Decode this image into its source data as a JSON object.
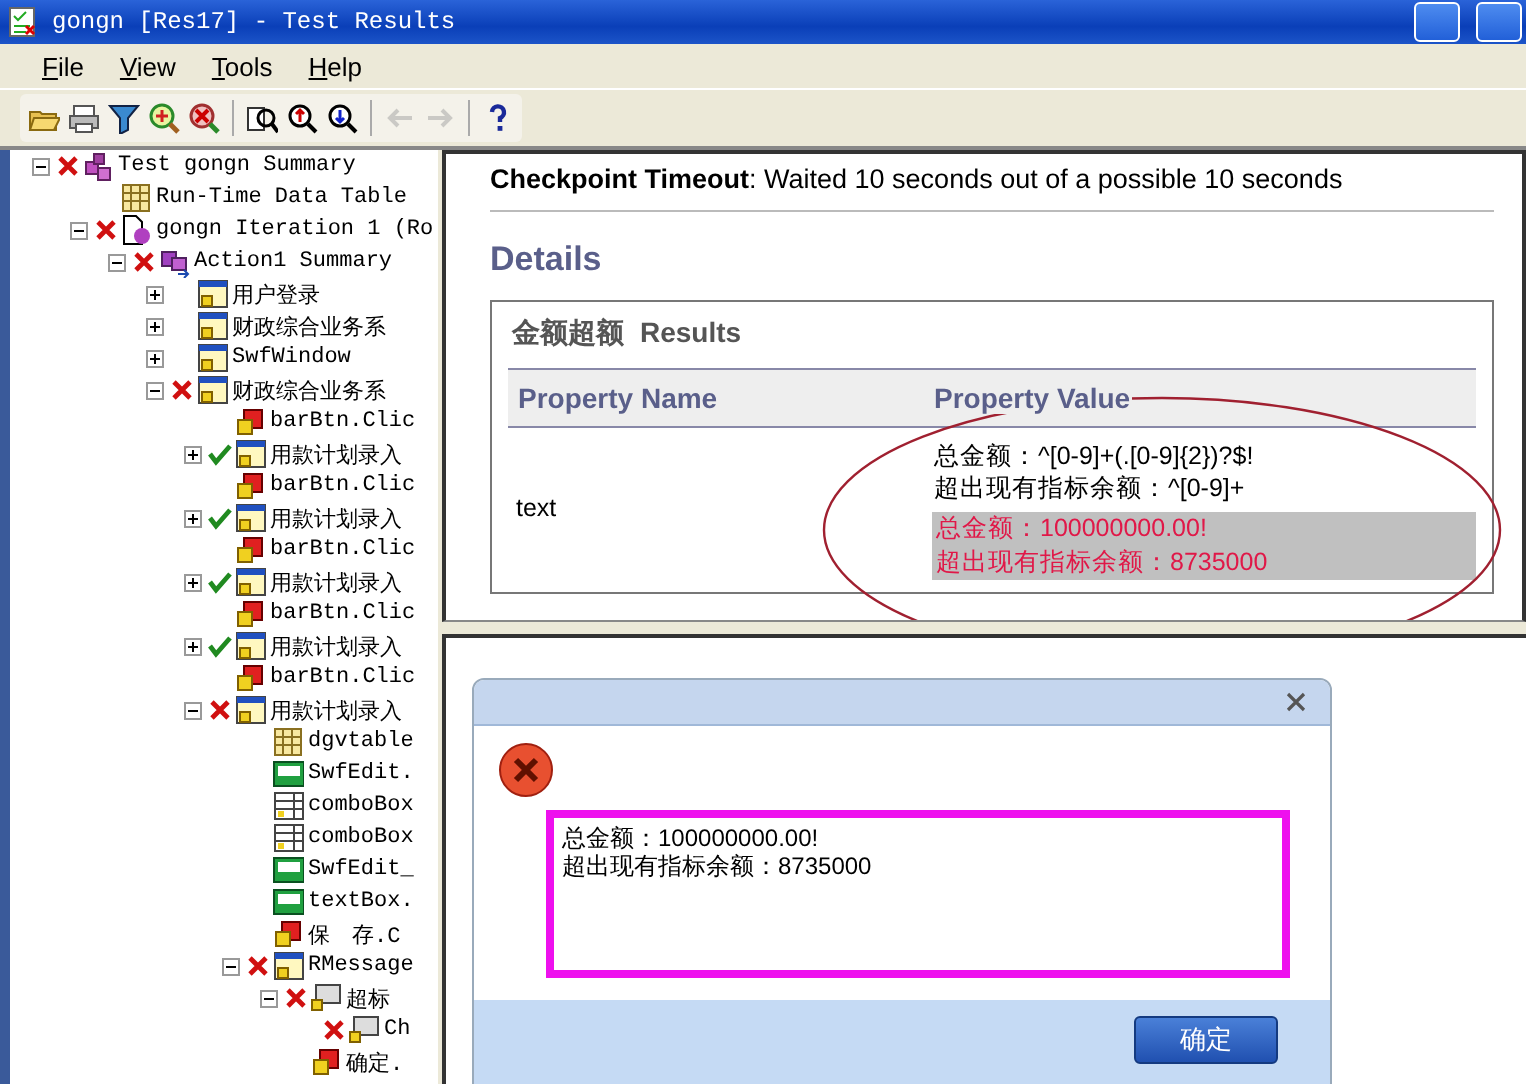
{
  "window": {
    "title": "gongn [Res17] - Test Results"
  },
  "menu": [
    {
      "label": "File"
    },
    {
      "label": "View"
    },
    {
      "label": "Tools"
    },
    {
      "label": "Help"
    }
  ],
  "toolbar": [
    {
      "kind": "open",
      "disabled": false
    },
    {
      "kind": "print",
      "disabled": false
    },
    {
      "kind": "filter",
      "disabled": false
    },
    {
      "kind": "find-add",
      "disabled": false
    },
    {
      "kind": "delete",
      "disabled": false
    },
    {
      "kind": "separator"
    },
    {
      "kind": "find",
      "disabled": false
    },
    {
      "kind": "zoom-up",
      "disabled": false
    },
    {
      "kind": "zoom-down",
      "disabled": false
    },
    {
      "kind": "separator"
    },
    {
      "kind": "back",
      "disabled": true
    },
    {
      "kind": "forward",
      "disabled": true
    },
    {
      "kind": "separator"
    },
    {
      "kind": "help",
      "disabled": false
    }
  ],
  "tree": [
    {
      "text": "Test gongn Summary",
      "kind": "summary",
      "failed": true,
      "passed": false,
      "expanded": true,
      "children": [
        {
          "text": "Run-Time Data Table",
          "kind": "table",
          "failed": false,
          "passed": false
        },
        {
          "text": "gongn Iteration 1 (Ro",
          "kind": "iteration",
          "failed": true,
          "passed": false,
          "expanded": true,
          "children": [
            {
              "text": "Action1 Summary",
              "kind": "action",
              "failed": true,
              "passed": false,
              "expanded": true,
              "children": [
                {
                  "text": "用户登录",
                  "kind": "window",
                  "failed": false,
                  "passed": false,
                  "expanded": false
                },
                {
                  "text": "财政综合业务系",
                  "kind": "window",
                  "failed": false,
                  "passed": false,
                  "expanded": false
                },
                {
                  "text": "SwfWindow",
                  "kind": "window",
                  "failed": false,
                  "passed": false,
                  "expanded": false
                },
                {
                  "text": "财政综合业务系",
                  "kind": "window",
                  "failed": true,
                  "passed": false,
                  "expanded": true,
                  "children": [
                    {
                      "text": "barBtn.Clic",
                      "kind": "step",
                      "failed": false,
                      "passed": false
                    },
                    {
                      "text": "用款计划录入",
                      "kind": "window",
                      "failed": false,
                      "passed": true,
                      "expanded": false
                    },
                    {
                      "text": "barBtn.Clic",
                      "kind": "step",
                      "failed": false,
                      "passed": false
                    },
                    {
                      "text": "用款计划录入",
                      "kind": "window",
                      "failed": false,
                      "passed": true,
                      "expanded": false
                    },
                    {
                      "text": "barBtn.Clic",
                      "kind": "step",
                      "failed": false,
                      "passed": false
                    },
                    {
                      "text": "用款计划录入",
                      "kind": "window",
                      "failed": false,
                      "passed": true,
                      "expanded": false
                    },
                    {
                      "text": "barBtn.Clic",
                      "kind": "step",
                      "failed": false,
                      "passed": false
                    },
                    {
                      "text": "用款计划录入",
                      "kind": "window",
                      "failed": false,
                      "passed": true,
                      "expanded": false
                    },
                    {
                      "text": "barBtn.Clic",
                      "kind": "step",
                      "failed": false,
                      "passed": false
                    },
                    {
                      "text": "用款计划录入",
                      "kind": "window",
                      "failed": true,
                      "passed": false,
                      "expanded": true,
                      "children": [
                        {
                          "text": "dgvtable",
                          "kind": "table",
                          "failed": false,
                          "passed": false
                        },
                        {
                          "text": "SwfEdit.",
                          "kind": "edit",
                          "failed": false,
                          "passed": false
                        },
                        {
                          "text": "comboBox",
                          "kind": "combo",
                          "failed": false,
                          "passed": false
                        },
                        {
                          "text": "comboBox",
                          "kind": "combo",
                          "failed": false,
                          "passed": false
                        },
                        {
                          "text": "SwfEdit_",
                          "kind": "edit",
                          "failed": false,
                          "passed": false
                        },
                        {
                          "text": "textBox.",
                          "kind": "edit",
                          "failed": false,
                          "passed": false
                        },
                        {
                          "text": "保　存.C",
                          "kind": "step",
                          "failed": false,
                          "passed": false
                        },
                        {
                          "text": "RMessage",
                          "kind": "window",
                          "failed": true,
                          "passed": false,
                          "expanded": true,
                          "children": [
                            {
                              "text": "超标",
                              "kind": "static",
                              "failed": true,
                              "passed": false,
                              "expanded": true,
                              "children": [
                                {
                                  "text": "Ch",
                                  "kind": "static",
                                  "failed": true,
                                  "passed": false
                                }
                              ]
                            },
                            {
                              "text": "确定.",
                              "kind": "step",
                              "failed": false,
                              "passed": false
                            }
                          ]
                        }
                      ]
                    }
                  ]
                }
              ]
            }
          ]
        }
      ]
    }
  ],
  "checkpoint": {
    "message": "**Checkpoint Timeout**: Waited 10 seconds out of a possible 10 seconds"
  },
  "details": {
    "heading": "Details",
    "results_name": "金额超额",
    "results_label": "Results",
    "columns": [
      "Property Name",
      "Property Value"
    ],
    "rows": [
      {
        "name": "text",
        "expected": [
          "总金额：^[0-9]+(.[0-9]{2})?$!",
          "超出现有指标余额：^[0-9]+"
        ],
        "actual": [
          "总金额：100000000.00!",
          "超出现有指标余额：8735000"
        ]
      }
    ]
  },
  "dialog": {
    "message": [
      "总金额：100000000.00!",
      "超出现有指标余额：8735000"
    ],
    "button": "确定"
  }
}
